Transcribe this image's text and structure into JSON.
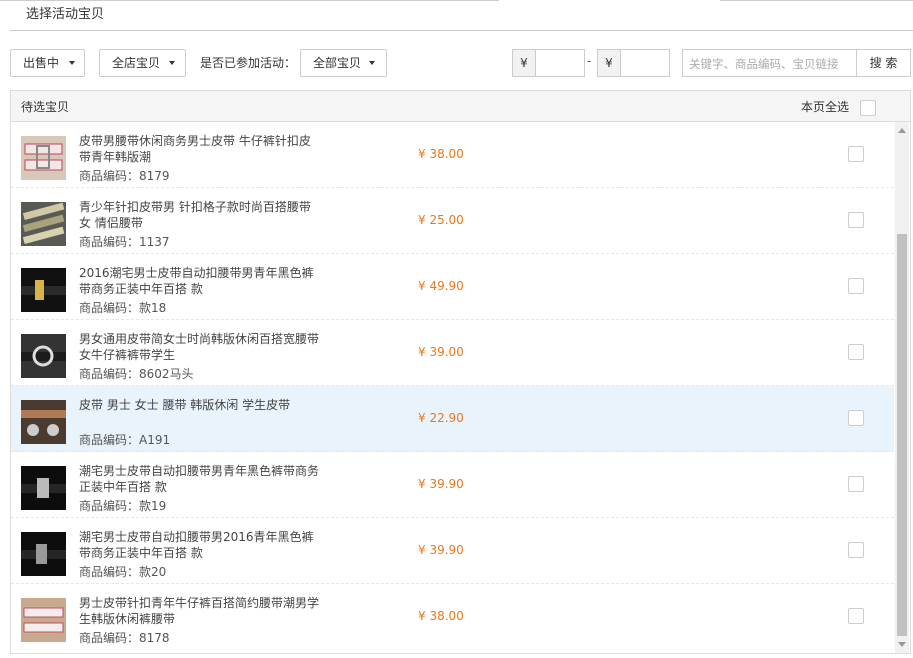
{
  "tab": {
    "label": "选择活动宝贝"
  },
  "filters": {
    "status": "出售中",
    "scope": "全店宝贝",
    "activity_label": "是否已参加活动：",
    "activity": "全部宝贝",
    "currency": "¥",
    "dash": "-",
    "min_price": "",
    "max_price": "",
    "search_placeholder": "关键字、商品编码、宝贝链接",
    "search_button": "搜 索"
  },
  "panel": {
    "title": "待选宝贝",
    "select_page_all": "本页全选",
    "code_prefix": "商品编码："
  },
  "products": [
    {
      "name": "皮带男腰带休闲商务男士皮带 牛仔裤针扣皮带青年韩版潮",
      "code": "商品编码：8179",
      "price": "¥ 38.00",
      "highlighted": false
    },
    {
      "name": "青少年针扣皮带男 针扣格子款时尚百搭腰带女 情侣腰带",
      "code": "商品编码：1137",
      "price": "¥ 25.00",
      "highlighted": false
    },
    {
      "name": "2016潮宅男士皮带自动扣腰带男青年黑色裤带商务正装中年百搭 款",
      "code": "商品编码：款18",
      "price": "¥ 49.90",
      "highlighted": false
    },
    {
      "name": "男女通用皮带简女士时尚韩版休闲百搭宽腰带女牛仔裤裤带学生",
      "code": "商品编码：8602马头",
      "price": "¥ 39.00",
      "highlighted": false
    },
    {
      "name": "皮带 男士 女士 腰带 韩版休闲 学生皮带",
      "code": "商品编码：A191",
      "price": "¥ 22.90",
      "highlighted": true
    },
    {
      "name": "潮宅男士皮带自动扣腰带男青年黑色裤带商务正装中年百搭 款",
      "code": "商品编码：款19",
      "price": "¥ 39.90",
      "highlighted": false
    },
    {
      "name": "潮宅男士皮带自动扣腰带男2016青年黑色裤带商务正装中年百搭 款",
      "code": "商品编码：款20",
      "price": "¥ 39.90",
      "highlighted": false
    },
    {
      "name": "男士皮带针扣青年牛仔裤百搭简约腰带潮男学生韩版休闲裤腰带",
      "code": "商品编码：8178",
      "price": "¥ 38.00",
      "highlighted": false
    }
  ],
  "colors": {
    "price": "#e8781b",
    "highlight_row": "#e9f3fb",
    "border": "#cccccc"
  }
}
